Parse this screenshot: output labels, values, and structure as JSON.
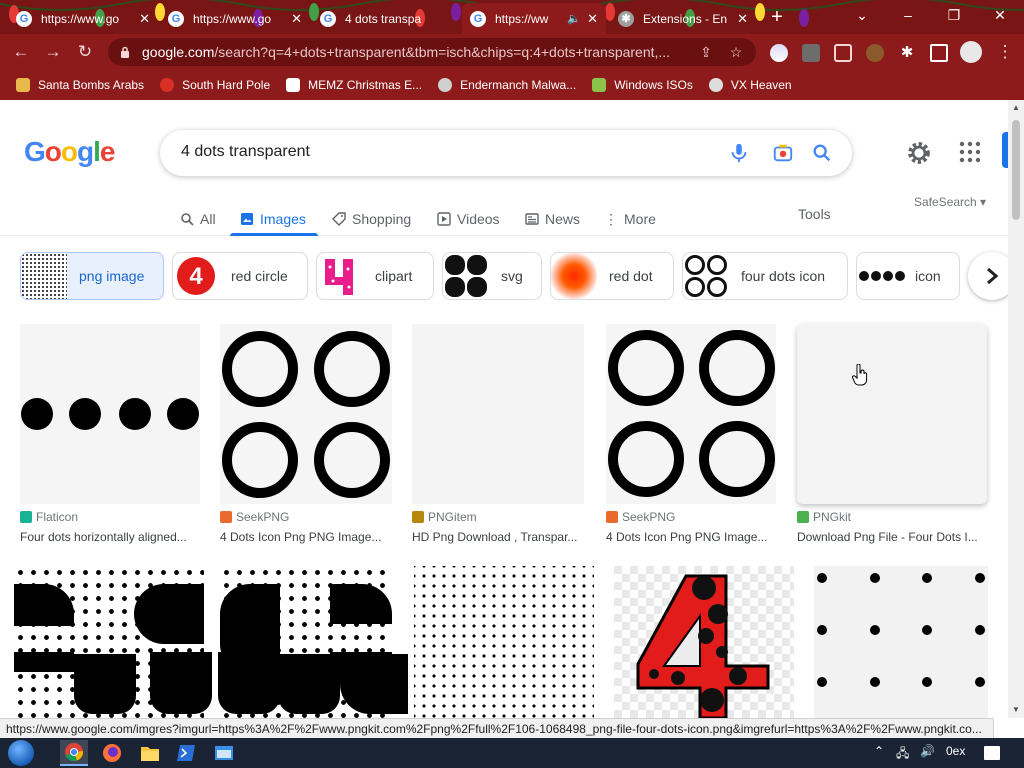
{
  "browser": {
    "tabs": [
      {
        "title": "https://www.go",
        "active": false
      },
      {
        "title": "https://www.go",
        "active": false
      },
      {
        "title": "4 dots transpa",
        "active": false
      },
      {
        "title": "https://ww",
        "active": true
      },
      {
        "title": "Extensions - En",
        "active": false
      }
    ],
    "url_host": "google.com",
    "url_rest": "/search?q=4+dots+transparent&tbm=isch&chips=q:4+dots+transparent,...",
    "bookmarks": [
      {
        "label": "Santa Bombs Arabs",
        "color": "#e8b84a"
      },
      {
        "label": "South Hard Pole",
        "color": "#d93025"
      },
      {
        "label": "MEMZ Christmas E...",
        "color": "#ffffff"
      },
      {
        "label": "Endermanch Malwa...",
        "color": "#cfcfcf"
      },
      {
        "label": "Windows ISOs",
        "color": "#8bc34a"
      },
      {
        "label": "VX Heaven",
        "color": "#dddddd"
      }
    ]
  },
  "google": {
    "query": "4 dots transparent",
    "nav_tabs": [
      {
        "label": "All",
        "icon": "search-icon",
        "selected": false
      },
      {
        "label": "Images",
        "icon": "image-icon",
        "selected": true
      },
      {
        "label": "Shopping",
        "icon": "tag-icon",
        "selected": false
      },
      {
        "label": "Videos",
        "icon": "play-icon",
        "selected": false
      },
      {
        "label": "News",
        "icon": "news-icon",
        "selected": false
      },
      {
        "label": "More",
        "icon": "more-vert-icon",
        "selected": false
      }
    ],
    "tools_label": "Tools",
    "safesearch_label": "SafeSearch",
    "chips": [
      {
        "label": "png image",
        "selected": true
      },
      {
        "label": "red circle",
        "selected": false
      },
      {
        "label": "clipart",
        "selected": false
      },
      {
        "label": "svg",
        "selected": false
      },
      {
        "label": "red dot",
        "selected": false
      },
      {
        "label": "four dots icon",
        "selected": false
      },
      {
        "label": "icon",
        "selected": false
      }
    ],
    "results": [
      {
        "source": "Flaticon",
        "title": "Four dots horizontally aligned...",
        "fav_color": "#19b394"
      },
      {
        "source": "SeekPNG",
        "title": "4 Dots Icon Png PNG Image...",
        "fav_color": "#e96a2c"
      },
      {
        "source": "PNGitem",
        "title": "HD Png Download , Transpar...",
        "fav_color": "#b8860b"
      },
      {
        "source": "SeekPNG",
        "title": "4 Dots Icon Png PNG Image...",
        "fav_color": "#e96a2c"
      },
      {
        "source": "PNGkit",
        "title": "Download Png File - Four Dots I...",
        "fav_color": "#4caf50"
      }
    ]
  },
  "status_url": "https://www.google.com/imgres?imgurl=https%3A%2F%2Fwww.pngkit.com%2Fpng%2Ffull%2F106-1068498_png-file-four-dots-icon.png&imgrefurl=https%3A%2F%2Fwww.pngkit.co...",
  "taskbar": {
    "tray_text": "0ex"
  },
  "colors": {
    "accent": "#1a73e8",
    "chrome_frame": "#8e1b1c",
    "taskbar": "#1b2434"
  }
}
